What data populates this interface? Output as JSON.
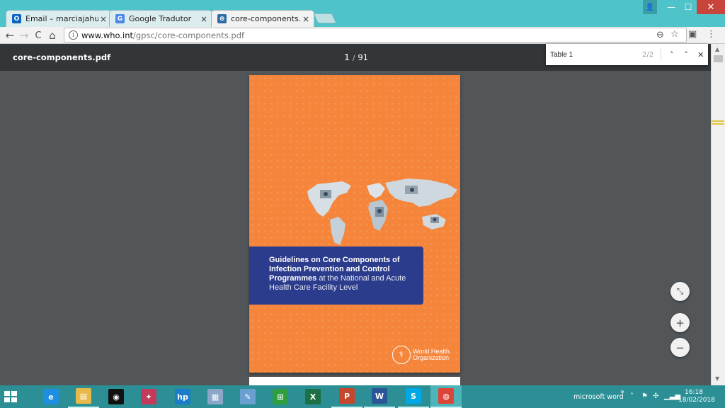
{
  "tabs": [
    {
      "label": "Email – marciajahu@live",
      "close": "×",
      "favicon": "outlook-icon",
      "color": "#0a64c2",
      "glyph": "O"
    },
    {
      "label": "Google Tradutor",
      "close": "×",
      "favicon": "translate-icon",
      "color": "#4a86e8",
      "glyph": "G"
    },
    {
      "label": "core-components.pdf",
      "close": "×",
      "favicon": "globe-icon",
      "color": "#2f6ea3",
      "glyph": "⊕"
    }
  ],
  "window_controls": {
    "user": "👤",
    "minimize": "—",
    "maximize": "☐",
    "close": "✕"
  },
  "toolbar": {
    "back": "←",
    "forward": "→",
    "reload": "C",
    "home": "⌂"
  },
  "address": {
    "host": "www.who.int",
    "path": "/gpsc/core-components.pdf",
    "info": "i"
  },
  "omni_icons": {
    "zoom": "⊖",
    "star": "☆",
    "extension": "▣",
    "menu": "⋮"
  },
  "pdf": {
    "title": "core-components.pdf",
    "current_page": "1",
    "separator": "/",
    "total_pages": "91"
  },
  "find": {
    "query": "Table 1",
    "count": "2/2",
    "prev": "˄",
    "next": "˅",
    "close": "✕"
  },
  "cover": {
    "title_bold": "Guidelines on Core Components of Infection Prevention and Control Programmes",
    "title_light": " at the National and Acute Health Care Facility Level",
    "org_line1": "World Health",
    "org_line2": "Organization",
    "background": "#f5853a",
    "banner_color": "#2c3c8c"
  },
  "zoom_buttons": {
    "fit": "⤡",
    "zoom_in": "+",
    "zoom_out": "−"
  },
  "taskbar": {
    "apps": [
      {
        "name": "internet-explorer-icon",
        "glyph": "e",
        "color": "#1e8fe0"
      },
      {
        "name": "file-explorer-icon",
        "glyph": "▤",
        "color": "#e8b84a"
      },
      {
        "name": "camera-app-icon",
        "glyph": "◉",
        "color": "#111111"
      },
      {
        "name": "photo-app-icon",
        "glyph": "✦",
        "color": "#c23b5b"
      },
      {
        "name": "hp-icon",
        "glyph": "hp",
        "color": "#1b7cc9"
      },
      {
        "name": "image-viewer-icon",
        "glyph": "▦",
        "color": "#8aa6c9"
      },
      {
        "name": "paint-icon",
        "glyph": "✎",
        "color": "#6a9fd1"
      },
      {
        "name": "store-icon",
        "glyph": "⊞",
        "color": "#2e9e3f"
      },
      {
        "name": "excel-icon",
        "glyph": "X",
        "color": "#1d7044"
      },
      {
        "name": "powerpoint-icon",
        "glyph": "P",
        "color": "#c6472b"
      },
      {
        "name": "word-icon",
        "glyph": "W",
        "color": "#2a5699"
      },
      {
        "name": "skype-icon",
        "glyph": "S",
        "color": "#00a8e6"
      },
      {
        "name": "chrome-icon",
        "glyph": "◍",
        "color": "#db4437"
      }
    ],
    "tray_label": "microsoft word",
    "tray_expand": "»",
    "time": "16:18",
    "date": "18/02/2018"
  }
}
